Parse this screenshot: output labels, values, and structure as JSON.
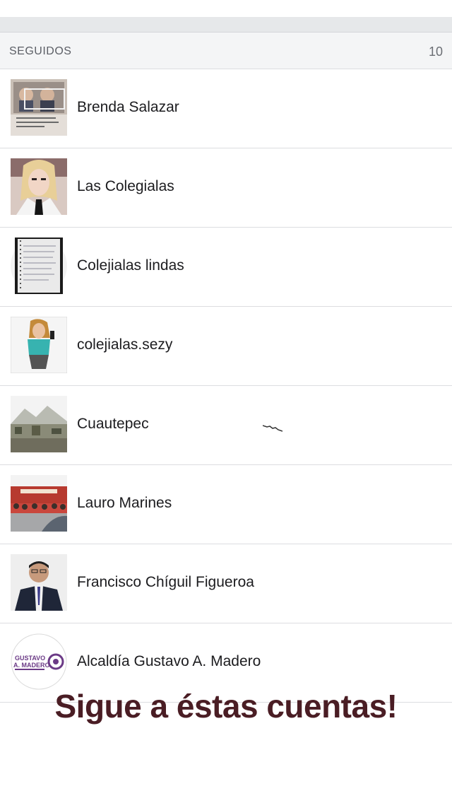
{
  "section": {
    "title": "SEGUIDOS",
    "count": "10"
  },
  "accounts": [
    {
      "name": "Brenda Salazar",
      "avatar_icon": "photo-collage"
    },
    {
      "name": "Las Colegialas",
      "avatar_icon": "girl-portrait"
    },
    {
      "name": "Colejialas lindas",
      "avatar_icon": "notebook-page"
    },
    {
      "name": "colejialas.sezy",
      "avatar_icon": "girl-selfie"
    },
    {
      "name": "Cuautepec",
      "avatar_icon": "mountain-landscape"
    },
    {
      "name": "Lauro Marines",
      "avatar_icon": "crowd-event"
    },
    {
      "name": "Francisco Chíguil Figueroa",
      "avatar_icon": "man-portrait"
    },
    {
      "name": "Alcaldía Gustavo A. Madero",
      "avatar_icon": "gam-logo",
      "logo_text": [
        "GUSTAVO",
        "A. MADERO"
      ]
    }
  ],
  "overlay": {
    "caption": "Sigue a éstas cuentas!"
  },
  "colors": {
    "caption": "#4a1d24",
    "header_bg": "#f4f5f6",
    "logo_purple": "#6b3a86"
  }
}
